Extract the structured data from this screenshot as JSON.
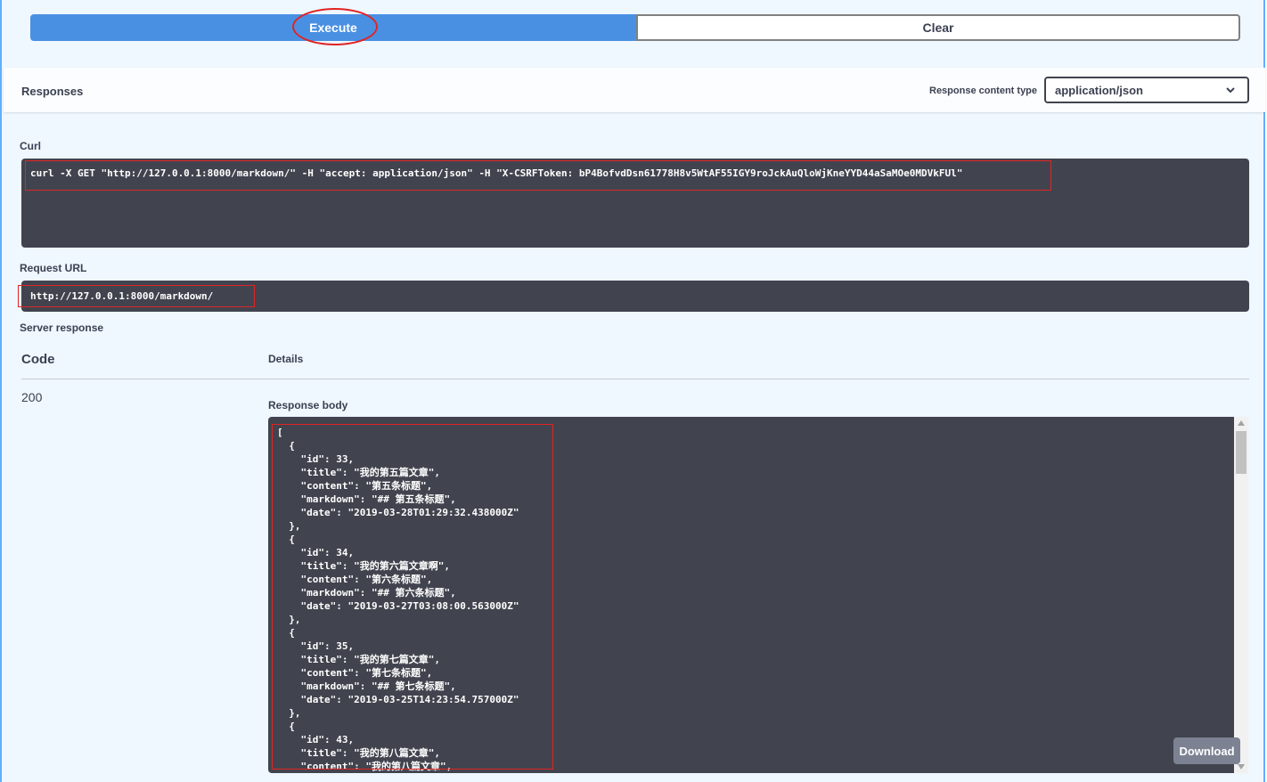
{
  "buttons": {
    "execute": "Execute",
    "clear": "Clear"
  },
  "responses": {
    "title": "Responses",
    "content_type_label": "Response content type",
    "content_type_value": "application/json"
  },
  "curl": {
    "label": "Curl",
    "command": "curl -X GET \"http://127.0.0.1:8000/markdown/\" -H \"accept: application/json\" -H \"X-CSRFToken: bP4BofvdDsn61778H8v5WtAF55IGY9roJckAuQloWjKneYYD44aSaMOe0MDVkFUl\""
  },
  "request_url": {
    "label": "Request URL",
    "value": "http://127.0.0.1:8000/markdown/"
  },
  "server_response": {
    "label": "Server response",
    "code_header": "Code",
    "details_header": "Details",
    "code": "200",
    "response_body_label": "Response body",
    "body": "[\n  {\n    \"id\": 33,\n    \"title\": \"我的第五篇文章\",\n    \"content\": \"第五条标题\",\n    \"markdown\": \"## 第五条标题\",\n    \"date\": \"2019-03-28T01:29:32.438000Z\"\n  },\n  {\n    \"id\": 34,\n    \"title\": \"我的第六篇文章啊\",\n    \"content\": \"第六条标题\",\n    \"markdown\": \"## 第六条标题\",\n    \"date\": \"2019-03-27T03:08:00.563000Z\"\n  },\n  {\n    \"id\": 35,\n    \"title\": \"我的第七篇文章\",\n    \"content\": \"第七条标题\",\n    \"markdown\": \"## 第七条标题\",\n    \"date\": \"2019-03-25T14:23:54.757000Z\"\n  },\n  {\n    \"id\": 43,\n    \"title\": \"我的第八篇文章\",\n    \"content\": \"我的第八篇文章\",",
    "download": "Download"
  },
  "colors": {
    "execute_bg": "#4990e2",
    "code_bg": "#41444e",
    "annotation_red": "#e02424",
    "panel_bg": "#eff7ff"
  },
  "icons": {
    "select_caret": "chevron-down-icon"
  }
}
